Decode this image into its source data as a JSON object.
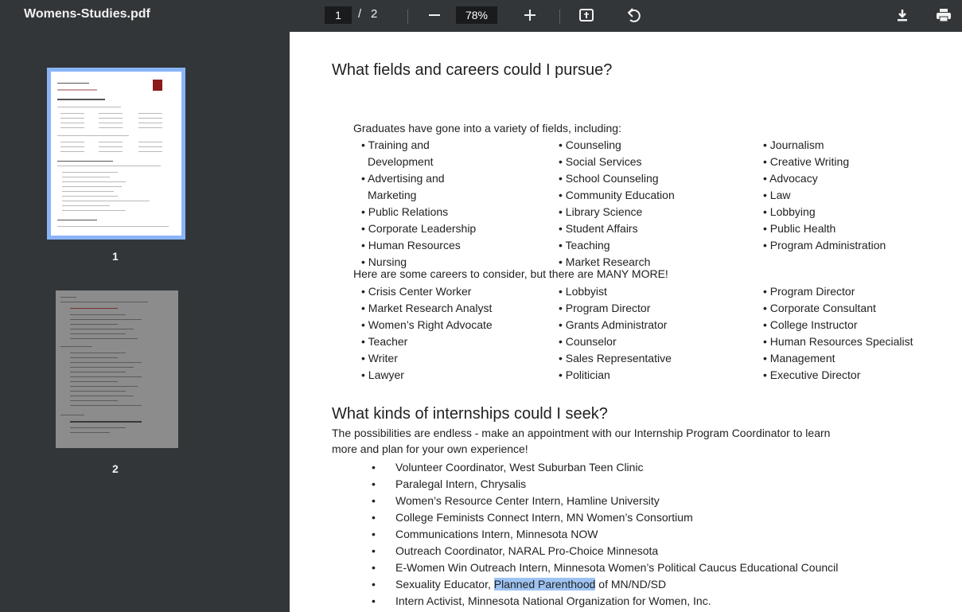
{
  "toolbar": {
    "filename": "Womens-Studies.pdf",
    "page_current": "1",
    "page_separator": "/",
    "page_total": "2",
    "zoom": "78%",
    "icons": [
      "minus-icon",
      "plus-icon",
      "fit-page-icon",
      "rotate-icon",
      "download-icon",
      "print-icon"
    ]
  },
  "sidebar": {
    "thumbs": [
      {
        "number": "1",
        "selected": true
      },
      {
        "number": "2",
        "selected": false
      }
    ]
  },
  "doc": {
    "section1_heading": "What fields and careers could I pursue?",
    "fields_intro": "Graduates have gone into a variety of fields, including:",
    "fields_col1": [
      "• Training and",
      "Development",
      "• Advertising and",
      "Marketing",
      "• Public Relations",
      "• Corporate Leadership",
      "• Human Resources",
      "• Nursing"
    ],
    "fields_col2": [
      "• Counseling",
      "• Social Services",
      "• School Counseling",
      "• Community Education",
      "• Library Science",
      "• Student Affairs",
      "• Teaching",
      "• Market Research"
    ],
    "fields_col3": [
      "• Journalism",
      "• Creative Writing",
      "• Advocacy",
      "• Law",
      "• Lobbying",
      "• Public Health",
      "• Program Administration"
    ],
    "careers_intro": "Here are some careers to consider, but there are MANY MORE!",
    "careers_col1": [
      "• Crisis Center Worker",
      "• Market Research Analyst",
      "• Women’s Right Advocate",
      "• Teacher",
      "• Writer",
      "• Lawyer"
    ],
    "careers_col2": [
      "• Lobbyist",
      "• Program Director",
      "• Grants Administrator",
      "• Counselor",
      "• Sales Representative",
      "• Politician"
    ],
    "careers_col3": [
      "• Program Director",
      "• Corporate Consultant",
      "• College Instructor",
      "• Human Resources Specialist",
      "• Management",
      "• Executive Director"
    ],
    "section2_heading": "What kinds of internships could I seek?",
    "intern_para_line1": "The possibilities are endless - make an appointment with our Internship Program Coordinator to learn",
    "intern_para_line2": "more and plan for your own experience!",
    "internships": [
      "Volunteer Coordinator, West Suburban Teen Clinic",
      "Paralegal Intern, Chrysalis",
      "Women’s Resource Center Intern, Hamline University",
      "College Feminists Connect Intern, MN Women’s Consortium",
      "Communications Intern, Minnesota NOW",
      "Outreach Coordinator, NARAL Pro-Choice Minnesota",
      "E-Women Win Outreach Intern, Minnesota Women’s Political Caucus Educational Council"
    ],
    "internship_8_prefix": "Sexuality Educator, ",
    "internship_8_highlight": "Planned Parenthood",
    "internship_8_suffix": " of MN/ND/SD",
    "internship_9": "Intern Activist, Minnesota National Organization for Women, Inc.",
    "bullet": "•"
  },
  "colors": {
    "toolbar_bg": "#323639",
    "viewer_bg": "#525659",
    "selected_thumb": "#8ab4f8",
    "highlight": "#9ec3f3"
  }
}
